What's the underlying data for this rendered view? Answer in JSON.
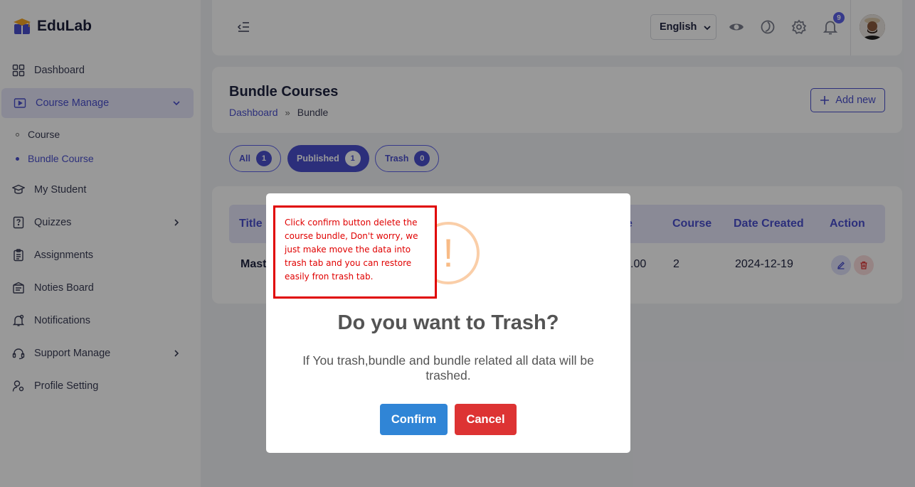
{
  "brand": {
    "name": "EduLab"
  },
  "sidebar": {
    "items": [
      {
        "label": "Dashboard",
        "icon": "grid-icon"
      },
      {
        "label": "Course Manage",
        "icon": "video-icon",
        "active": true,
        "expanded": true
      },
      {
        "label": "My Student",
        "icon": "graduation-cap-icon"
      },
      {
        "label": "Quizzes",
        "icon": "quiz-icon",
        "has_children": true
      },
      {
        "label": "Assignments",
        "icon": "clipboard-icon"
      },
      {
        "label": "Noties Board",
        "icon": "notice-board-icon"
      },
      {
        "label": "Notifications",
        "icon": "bell-icon"
      },
      {
        "label": "Support Manage",
        "icon": "headset-icon",
        "has_children": true
      },
      {
        "label": "Profile Setting",
        "icon": "user-gear-icon"
      }
    ],
    "sub_items": [
      {
        "label": "Course",
        "active": false
      },
      {
        "label": "Bundle Course",
        "active": true
      }
    ]
  },
  "header": {
    "language": "English",
    "notification_count": "9",
    "icons": [
      "menu-collapse-icon",
      "eye-icon",
      "theme-icon",
      "settings-icon",
      "bell-icon"
    ]
  },
  "page": {
    "title": "Bundle Courses",
    "breadcrumb": {
      "home": "Dashboard",
      "separator": "»",
      "current": "Bundle"
    },
    "add_button": "Add new"
  },
  "tabs": [
    {
      "label": "All",
      "count": "1",
      "active": false
    },
    {
      "label": "Published",
      "count": "1",
      "active": true
    },
    {
      "label": "Trash",
      "count": "0",
      "active": false
    }
  ],
  "table": {
    "columns": [
      "Title",
      "e",
      "Course",
      "Date Created",
      "Action"
    ],
    "row": {
      "title": "Mast",
      "price": ".00",
      "course": "2",
      "date": "2024-12-19"
    }
  },
  "modal": {
    "icon": "!",
    "title": "Do you want to Trash?",
    "text": "If You trash,bundle and bundle related all data will be trashed.",
    "confirm": "Confirm",
    "cancel": "Cancel"
  },
  "annotation": {
    "text": "Click confirm button delete the course bundle, Don't worry, we just make move the data into trash tab and you can restore easily fron trash tab."
  },
  "colors": {
    "accent": "#4a4fce",
    "confirm": "#3085d6",
    "cancel": "#dd3333",
    "annotation": "#e00000",
    "warning": "#f8bb86"
  }
}
